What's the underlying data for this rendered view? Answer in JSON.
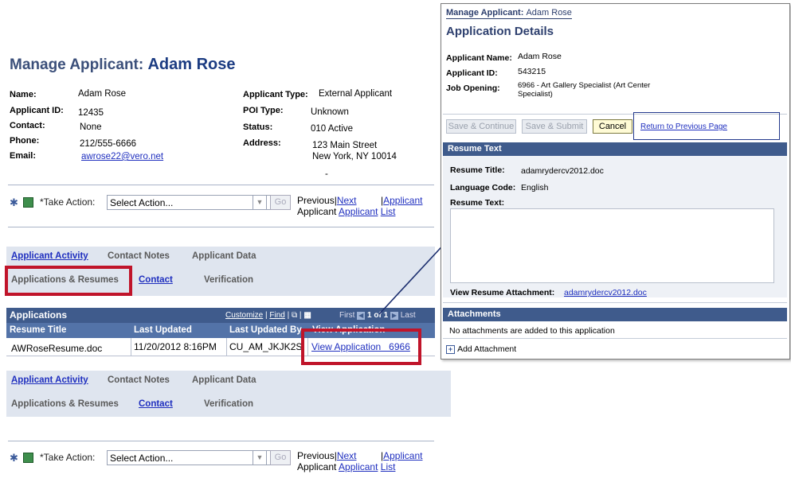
{
  "main": {
    "title_prefix": "Manage Applicant:",
    "title_name": "Adam Rose",
    "fields_left": [
      {
        "label": "Name:",
        "value": "Adam Rose"
      },
      {
        "label": "Applicant ID:",
        "value": "12435"
      },
      {
        "label": "Contact:",
        "value": "None"
      },
      {
        "label": "Phone:",
        "value": "212/555-6666"
      },
      {
        "label": "Email:",
        "value": "awrose22@vero.net"
      }
    ],
    "fields_right": [
      {
        "label": "Applicant Type:",
        "value": "External Applicant"
      },
      {
        "label": "POI Type:",
        "value": "Unknown"
      },
      {
        "label": "Status:",
        "value": "010 Active"
      },
      {
        "label": "Address:",
        "value_line1": "123 Main Street",
        "value_line2": "New York, NY 10014",
        "value_line3": "-"
      }
    ],
    "action": {
      "label": "*Take Action:",
      "select_value": "Select Action...",
      "go": "Go",
      "previous": "Previous",
      "sep": "|",
      "next": "Next",
      "applicant": "Applicant",
      "applicant_list_a": "Applicant",
      "applicant_word": "Applicant",
      "list": "List"
    },
    "tabs_row1": [
      "Applicant Activity",
      "Contact Notes",
      "Applicant Data"
    ],
    "tabs_row2": [
      "Applications & Resumes",
      "Contact",
      "Verification"
    ],
    "applications": {
      "title": "Applications",
      "customize": "Customize",
      "find": "Find",
      "first": "First",
      "range": "1 of 1",
      "last": "Last",
      "columns": [
        "Resume Title",
        "Last Updated",
        "Last Updated By",
        "View Application"
      ],
      "row": {
        "resume": "AWRoseResume.doc",
        "updated": "11/20/2012 8:16PM",
        "by": "CU_AM_JKJK2S",
        "view": "View Application   6966"
      }
    }
  },
  "details": {
    "breadcrumb": "Manage Applicant:",
    "breadcrumb_name": "Adam Rose",
    "title": "Application Details",
    "fields": [
      {
        "label": "Applicant Name:",
        "value": "Adam Rose"
      },
      {
        "label": "Applicant ID:",
        "value": "543215"
      },
      {
        "label": "Job Opening:",
        "value": "6966 - Art Gallery Specialist (Art Center Specialist)"
      }
    ],
    "buttons": {
      "save_continue": "Save & Continue",
      "save_submit": "Save & Submit",
      "cancel": "Cancel",
      "return": "Return to Previous Page"
    },
    "resume_text_header": "Resume Text",
    "resume_title_label": "Resume Title:",
    "resume_title_value": "adamrydercv2012.doc",
    "language_label": "Language Code:",
    "language_value": "English",
    "resume_text_label": "Resume Text:",
    "attachment_label": "View Resume Attachment:",
    "attachment_value": "adamrydercv2012.doc",
    "attachments_header": "Attachments",
    "no_attachments": "No attachments are added to this application",
    "add_attachment": "Add Attachment"
  }
}
